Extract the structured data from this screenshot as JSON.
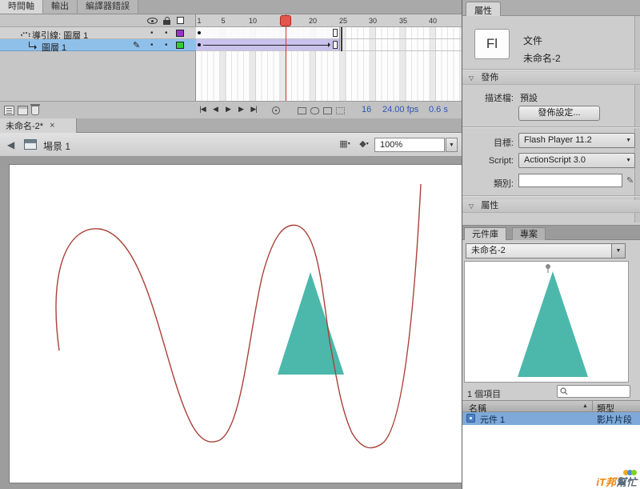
{
  "colors": {
    "playhead": "#cf3a34",
    "tween_span": "#c9c2ec",
    "triangle": "#4cb8ab",
    "curve": "#a8423a",
    "guide_layer_swatch": "#9933cc",
    "layer_swatch": "#33cc33",
    "selected_layer_row": "#8fc0ea",
    "selected_library_row": "#7fa9d8",
    "frame_counter_blue": "#2b55b2"
  },
  "timeline": {
    "tabs": [
      {
        "label": "時間軸"
      },
      {
        "label": "輸出"
      },
      {
        "label": "編譯器錯誤"
      }
    ],
    "frame_numbers": [
      "1",
      "5",
      "10",
      "15",
      "20",
      "25",
      "30",
      "35",
      "40"
    ],
    "layers": [
      {
        "name": "導引線: 圖層 1"
      },
      {
        "name": "圖層 1"
      }
    ],
    "transport": {
      "first": "|◀",
      "prev": "◀",
      "play": "▶",
      "next": "▶",
      "last": "▶|"
    },
    "status": {
      "current_frame": "16",
      "frame_rate": "24.00 fps",
      "elapsed_time": "0.6 s"
    }
  },
  "document_tab": {
    "label": "未命名-2*"
  },
  "edit_bar": {
    "scene_label": "場景 1",
    "zoom_value": "100%"
  },
  "properties_panel": {
    "tab_label": "屬性",
    "logo": "Fl",
    "doc_type": "文件",
    "doc_name": "未命名-2",
    "publish": {
      "section_label": "發佈",
      "profile_label": "描述檔:",
      "profile_value": "預設",
      "publish_settings_button": "發佈設定...",
      "target_label": "目標:",
      "target_value": "Flash Player 11.2",
      "script_label": "Script:",
      "script_value": "ActionScript 3.0",
      "class_label": "類別:"
    },
    "properties_section_label": "屬性"
  },
  "library_panel": {
    "tabs": [
      {
        "label": "元件庫"
      },
      {
        "label": "專案"
      }
    ],
    "document_select": "未命名-2",
    "item_count": "1 個項目",
    "columns": {
      "name": "名稱",
      "type": "類型"
    },
    "items": [
      {
        "name": "元件 1",
        "type": "影片片段"
      }
    ]
  },
  "watermark": {
    "part1": "iT邦",
    "part2": "幫忙"
  }
}
